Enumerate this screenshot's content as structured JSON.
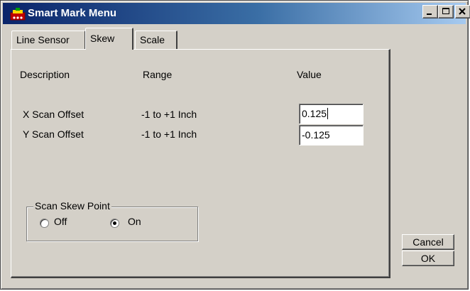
{
  "window": {
    "title": "Smart Mark Menu",
    "title_bar_colors": [
      "#0a246a",
      "#a6caf0"
    ]
  },
  "title_controls": {
    "minimize_icon": "minimize-icon",
    "maximize_icon": "maximize-icon",
    "close_icon": "close-icon"
  },
  "tabs": [
    {
      "label": "Line Sensor",
      "selected": false
    },
    {
      "label": "Skew",
      "selected": true
    },
    {
      "label": "Scale",
      "selected": false
    }
  ],
  "headers": {
    "description": "Description",
    "range": "Range",
    "value": "Value"
  },
  "rows": [
    {
      "description": "X Scan Offset",
      "range": "-1 to +1 Inch",
      "value": "0.125"
    },
    {
      "description": "Y Scan Offset",
      "range": "-1 to +1 Inch",
      "value": "-0.125"
    }
  ],
  "skew_point": {
    "legend": "Scan Skew Point",
    "options": [
      {
        "label": "Off",
        "selected": false
      },
      {
        "label": "On",
        "selected": true
      }
    ]
  },
  "buttons": {
    "cancel": "Cancel",
    "ok": "OK"
  }
}
